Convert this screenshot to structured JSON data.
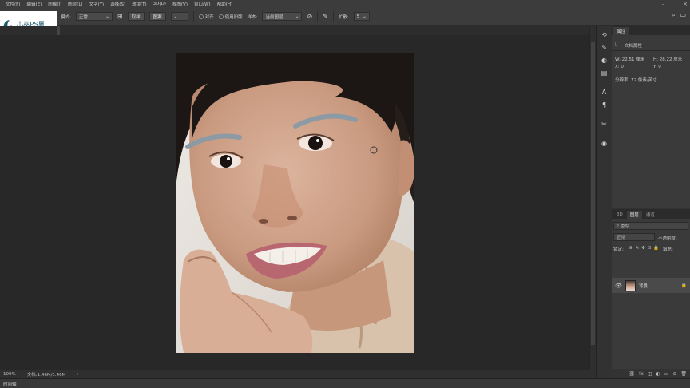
{
  "menu": {
    "items": [
      "文件(F)",
      "编辑(E)",
      "图像(I)",
      "图层(L)",
      "文字(Y)",
      "选择(S)",
      "滤镜(T)",
      "3D(D)",
      "视图(V)",
      "窗口(W)",
      "帮助(H)"
    ]
  },
  "options": {
    "mode_label": "模式:",
    "mode_value": "正常",
    "source_button": "取样",
    "pattern_button": "图案",
    "aligned_label": "对齐",
    "use_legacy_label": "使用旧版",
    "sample_label": "样本:",
    "sample_value": "当前图层",
    "diffusion_label": "扩散:",
    "diffusion_value": "5"
  },
  "logo": {
    "text": "小巫PS屋"
  },
  "status": {
    "zoom": "100%",
    "doc_size": "文档:1.46M/1.46M",
    "arrow": "›"
  },
  "timeline": {
    "label": "时间轴"
  },
  "properties": {
    "tab": "属性",
    "section": "文档属性",
    "width_label": "W:",
    "width_value": "22.51",
    "width_unit": "厘米",
    "height_label": "H:",
    "height_value": "28.22",
    "height_unit": "厘米",
    "x_label": "X:",
    "x_value": "0",
    "y_label": "Y:",
    "y_value": "0",
    "resolution": "分辨率: 72 像素/英寸"
  },
  "layers": {
    "tabs": [
      "3D",
      "图层",
      "通道"
    ],
    "active_tab": "图层",
    "search_placeholder": "类型",
    "blend_mode": "正常",
    "opacity_label": "不透明度:",
    "lock_label": "锁定:",
    "fill_label": "填充:",
    "layer_name": "背景"
  },
  "colors": {
    "accent": "#1b5a6e",
    "panel": "#3a3a3a",
    "canvas_bg": "#282828"
  }
}
